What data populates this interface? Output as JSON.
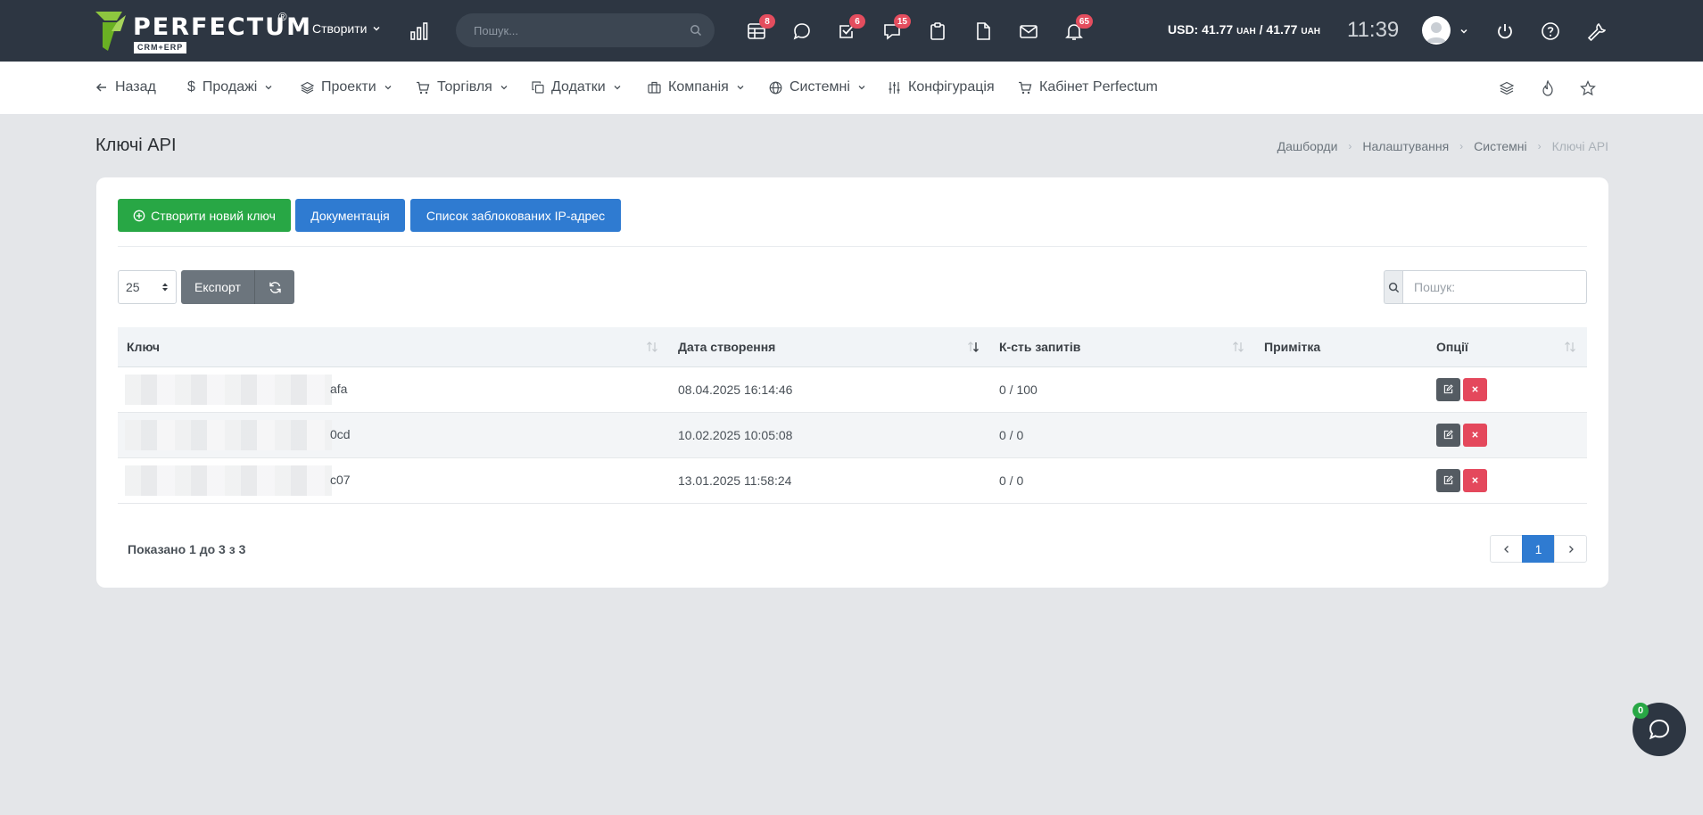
{
  "brand": {
    "name": "PERFECTUM",
    "registered": "®",
    "tagline": "CRM+ERP"
  },
  "topbar": {
    "create_label": "Створити",
    "search_placeholder": "Пошук...",
    "badges": {
      "tables": "8",
      "tasks": "6",
      "comments": "15",
      "notifications": "65"
    },
    "currency_prefix": "USD: ",
    "rate_buy": "41.77",
    "rate_sell": "41.77",
    "currency_unit": "UAH",
    "currency_sep": " / ",
    "time": "11:39"
  },
  "nav": {
    "back": "Назад",
    "sales": "Продажі",
    "projects": "Проекти",
    "trade": "Торгівля",
    "addons": "Додатки",
    "company": "Компанія",
    "system": "Системні",
    "config": "Конфігурація",
    "cabinet": "Кабінет Perfectum"
  },
  "page": {
    "title": "Ключі API"
  },
  "breadcrumb": [
    "Дашборди",
    "Налаштування",
    "Системні",
    "Ключі API"
  ],
  "actions": {
    "create_key": "Створити новий ключ",
    "docs": "Документація",
    "blocked_ips": "Список заблокованих IP-адрес"
  },
  "toolbar": {
    "page_size": "25",
    "export": "Експорт",
    "search_placeholder": "Пошук:"
  },
  "table": {
    "columns": [
      "Ключ",
      "Дата створення",
      "К-сть запитів",
      "Примітка",
      "Опції"
    ],
    "rows": [
      {
        "key_tail": "afa",
        "created": "08.04.2025 16:14:46",
        "requests": "0 / 100",
        "note": ""
      },
      {
        "key_tail": "0cd",
        "created": "10.02.2025 10:05:08",
        "requests": "0 / 0",
        "note": ""
      },
      {
        "key_tail": "c07",
        "created": "13.01.2025 11:58:24",
        "requests": "0 / 0",
        "note": ""
      }
    ]
  },
  "footer": {
    "shown": "Показано 1 до 3 з 3",
    "current_page": "1"
  },
  "chat": {
    "unread": "0"
  },
  "colors": {
    "topbar": "#2d3642",
    "accent_blue": "#2f7bd1",
    "accent_green": "#28a745",
    "danger": "#e4485c"
  }
}
